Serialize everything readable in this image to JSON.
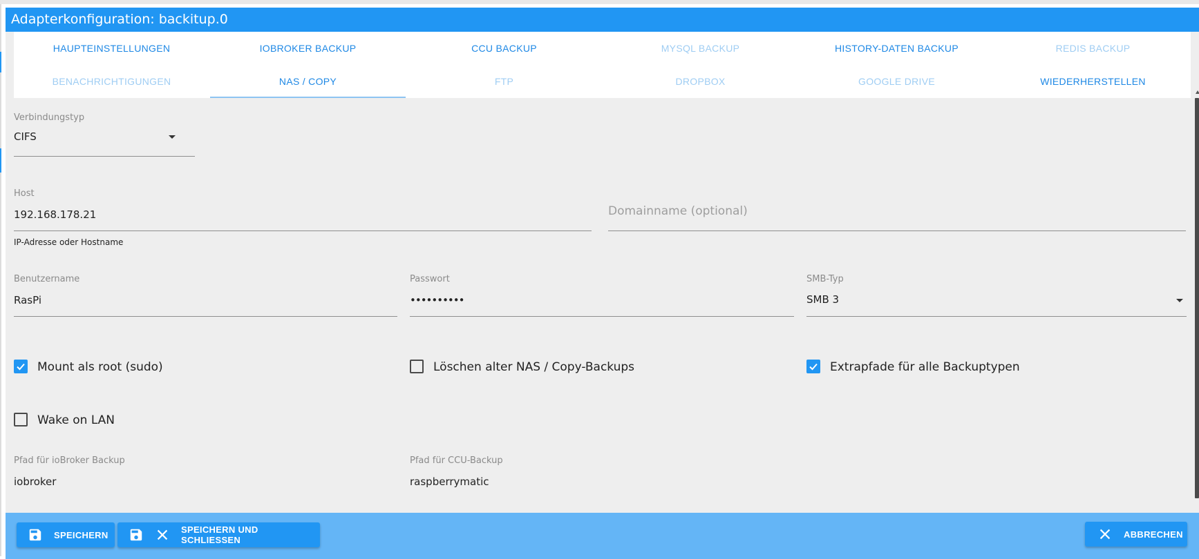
{
  "window": {
    "title": "Adapterkonfiguration: backitup.0"
  },
  "tabs": [
    {
      "label": "HAUPTEINSTELLUNGEN",
      "state": "enabled"
    },
    {
      "label": "IOBROKER BACKUP",
      "state": "enabled"
    },
    {
      "label": "CCU BACKUP",
      "state": "enabled"
    },
    {
      "label": "MYSQL BACKUP",
      "state": "disabled"
    },
    {
      "label": "HISTORY-DATEN BACKUP",
      "state": "enabled"
    },
    {
      "label": "REDIS BACKUP",
      "state": "disabled"
    },
    {
      "label": "BENACHRICHTIGUNGEN",
      "state": "disabled"
    },
    {
      "label": "NAS / COPY",
      "state": "selected"
    },
    {
      "label": "FTP",
      "state": "disabled"
    },
    {
      "label": "DROPBOX",
      "state": "disabled"
    },
    {
      "label": "GOOGLE DRIVE",
      "state": "disabled"
    },
    {
      "label": "WIEDERHERSTELLEN",
      "state": "enabled"
    }
  ],
  "form": {
    "connection_type": {
      "label": "Verbindungstyp",
      "value": "CIFS"
    },
    "host": {
      "label": "Host",
      "value": "192.168.178.21",
      "helper": "IP-Adresse oder Hostname"
    },
    "domain": {
      "placeholder": "Domainname (optional)",
      "value": ""
    },
    "username": {
      "label": "Benutzername",
      "value": "RasPi"
    },
    "password": {
      "label": "Passwort",
      "value": "••••••••••"
    },
    "smb_type": {
      "label": "SMB-Typ",
      "value": "SMB 3"
    },
    "checkboxes": {
      "mount_root": {
        "label": "Mount als root (sudo)",
        "checked": true
      },
      "delete_old": {
        "label": "Löschen alter NAS / Copy-Backups",
        "checked": false
      },
      "extra_paths": {
        "label": "Extrapfade für alle Backuptypen",
        "checked": true
      },
      "wake_on_lan": {
        "label": "Wake on LAN",
        "checked": false
      }
    },
    "path_iobroker": {
      "label": "Pfad für ioBroker Backup",
      "value": "iobroker"
    },
    "path_ccu": {
      "label": "Pfad für CCU-Backup",
      "value": "raspberrymatic"
    }
  },
  "footer": {
    "save_label": "SPEICHERN",
    "save_close_label": "SPEICHERN UND SCHLIESSEN",
    "cancel_label": "ABBRECHEN"
  },
  "colors": {
    "primary": "#2196f3",
    "footer": "#64b5f6",
    "tab_text": "#1e88e5",
    "tab_disabled": "#9fcdf3"
  }
}
